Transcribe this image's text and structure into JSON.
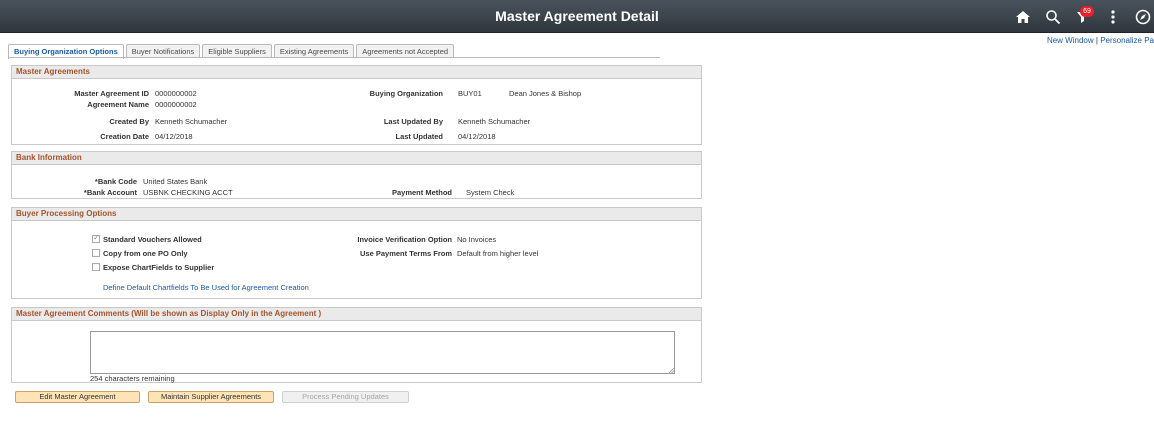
{
  "header": {
    "title": "Master Agreement Detail",
    "notification_count": "69",
    "new_window": "New Window",
    "separator": "|",
    "personalize": "Personalize Pa"
  },
  "tabs": [
    {
      "label": "Buying Organization Options",
      "active": true
    },
    {
      "label": "Buyer Notifications"
    },
    {
      "label": "Eligible Suppliers"
    },
    {
      "label": "Existing Agreements"
    },
    {
      "label": "Agreements not Accepted"
    }
  ],
  "master": {
    "title": "Master Agreements",
    "id_label": "Master Agreement ID",
    "id_value": "0000000002",
    "name_label": "Agreement Name",
    "name_value": "0000000002",
    "created_by_label": "Created By",
    "created_by_value": "Kenneth Schumacher",
    "creation_date_label": "Creation Date",
    "creation_date_value": "04/12/2018",
    "buying_org_label": "Buying Organization",
    "buying_org_code": "BUY01",
    "buying_org_name": "Dean Jones & Bishop",
    "last_updated_by_label": "Last Updated By",
    "last_updated_by_value": "Kenneth Schumacher",
    "last_updated_label": "Last Updated",
    "last_updated_value": "04/12/2018"
  },
  "bank": {
    "title": "Bank Information",
    "code_label": "*Bank Code",
    "code_value": "United States Bank",
    "account_label": "*Bank Account",
    "account_value": "USBNK CHECKING ACCT",
    "payment_label": "Payment Method",
    "payment_value": "System Check"
  },
  "processing": {
    "title": "Buyer Processing Options",
    "standard_vouchers": "Standard Vouchers Allowed",
    "copy_po": "Copy from one PO Only",
    "expose_chartfields": "Expose ChartFields to Supplier",
    "define_link": "Define Default Chartfields To Be Used for Agreement Creation",
    "invoice_label": "Invoice Verification Option",
    "invoice_value": "No Invoices",
    "payment_terms_label": "Use Payment Terms From",
    "payment_terms_value": "Default from higher level"
  },
  "comments": {
    "title": "Master Agreement Comments (Will be shown as Display Only in the Agreement )",
    "remaining": "254 characters remaining"
  },
  "buttons": {
    "edit": "Edit Master Agreement",
    "maintain": "Maintain Supplier Agreements",
    "process": "Process Pending Updates"
  },
  "colors": {
    "header_bg": "#3a4249",
    "section_title": "#a5542b",
    "link": "#1b5aa5",
    "button_bg": "#fde3b6",
    "badge": "#e8202a"
  }
}
